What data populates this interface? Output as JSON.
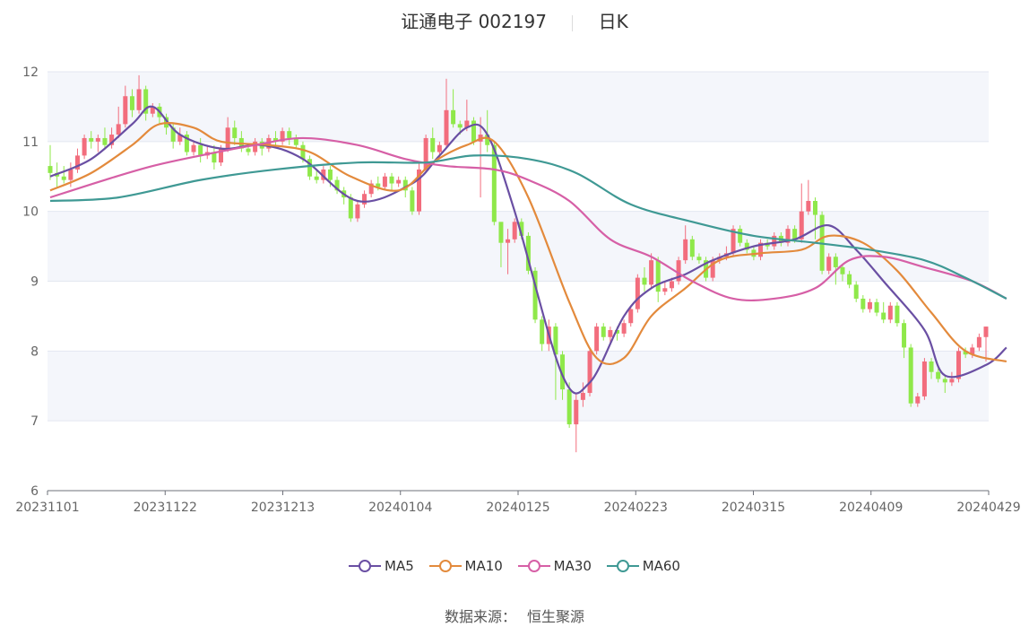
{
  "header": {
    "stock_name": "证通电子 002197",
    "period": "日K"
  },
  "source": {
    "label": "数据来源：",
    "provider": "恒生聚源"
  },
  "legend": [
    {
      "name": "MA5",
      "color": "#6a4fa3"
    },
    {
      "name": "MA10",
      "color": "#e38a3c"
    },
    {
      "name": "MA30",
      "color": "#d65fa6"
    },
    {
      "name": "MA60",
      "color": "#3f9994"
    }
  ],
  "colors": {
    "up": "#f26d7d",
    "down": "#8fe84a",
    "band": "#f4f6fb",
    "grid": "#e3e7f0"
  },
  "chart_data": {
    "type": "candlestick",
    "title": "证通电子 002197",
    "ylim": [
      6,
      12
    ],
    "y_ticks": [
      6,
      7,
      8,
      9,
      10,
      11,
      12
    ],
    "x_ticks": [
      "20231101",
      "20231122",
      "20231213",
      "20240104",
      "20240125",
      "20240223",
      "20240315",
      "20240409",
      "20240429"
    ],
    "candles": [
      [
        10.65,
        10.55,
        10.95,
        10.45
      ],
      [
        10.55,
        10.5,
        10.7,
        10.35
      ],
      [
        10.5,
        10.45,
        10.65,
        10.4
      ],
      [
        10.45,
        10.6,
        10.7,
        10.35
      ],
      [
        10.6,
        10.8,
        10.9,
        10.55
      ],
      [
        10.8,
        11.05,
        11.1,
        10.75
      ],
      [
        11.05,
        11.0,
        11.15,
        10.9
      ],
      [
        11.0,
        11.05,
        11.1,
        10.85
      ],
      [
        11.05,
        10.95,
        11.2,
        10.9
      ],
      [
        10.95,
        11.1,
        11.2,
        10.9
      ],
      [
        11.1,
        11.25,
        11.5,
        11.05
      ],
      [
        11.25,
        11.65,
        11.8,
        11.2
      ],
      [
        11.65,
        11.45,
        11.75,
        11.35
      ],
      [
        11.45,
        11.75,
        11.95,
        11.4
      ],
      [
        11.75,
        11.4,
        11.8,
        11.3
      ],
      [
        11.4,
        11.5,
        11.55,
        11.35
      ],
      [
        11.5,
        11.35,
        11.55,
        11.25
      ],
      [
        11.35,
        11.2,
        11.4,
        11.1
      ],
      [
        11.2,
        11.0,
        11.25,
        10.9
      ],
      [
        11.0,
        11.1,
        11.2,
        10.95
      ],
      [
        11.1,
        10.85,
        11.15,
        10.8
      ],
      [
        10.85,
        10.95,
        11.0,
        10.8
      ],
      [
        10.95,
        10.8,
        11.05,
        10.7
      ],
      [
        10.8,
        10.85,
        10.95,
        10.75
      ],
      [
        10.85,
        10.7,
        10.95,
        10.6
      ],
      [
        10.7,
        10.9,
        10.95,
        10.65
      ],
      [
        10.9,
        11.2,
        11.35,
        10.85
      ],
      [
        11.2,
        11.05,
        11.3,
        10.95
      ],
      [
        11.05,
        10.9,
        11.15,
        10.85
      ],
      [
        10.9,
        10.85,
        10.95,
        10.8
      ],
      [
        10.85,
        11.0,
        11.05,
        10.8
      ],
      [
        11.0,
        10.9,
        11.05,
        10.8
      ],
      [
        10.9,
        11.05,
        11.1,
        10.85
      ],
      [
        11.05,
        11.0,
        11.15,
        10.95
      ],
      [
        11.0,
        11.15,
        11.2,
        10.95
      ],
      [
        11.15,
        11.05,
        11.2,
        10.95
      ],
      [
        11.05,
        10.95,
        11.1,
        10.9
      ],
      [
        10.95,
        10.75,
        11.0,
        10.7
      ],
      [
        10.75,
        10.5,
        10.8,
        10.45
      ],
      [
        10.5,
        10.45,
        10.6,
        10.4
      ],
      [
        10.45,
        10.6,
        10.65,
        10.4
      ],
      [
        10.6,
        10.45,
        10.65,
        10.35
      ],
      [
        10.45,
        10.3,
        10.5,
        10.25
      ],
      [
        10.3,
        10.2,
        10.35,
        10.1
      ],
      [
        10.2,
        9.9,
        10.25,
        9.85
      ],
      [
        9.9,
        10.1,
        10.15,
        9.85
      ],
      [
        10.1,
        10.25,
        10.3,
        10.05
      ],
      [
        10.25,
        10.4,
        10.45,
        10.2
      ],
      [
        10.4,
        10.35,
        10.5,
        10.3
      ],
      [
        10.35,
        10.5,
        10.55,
        10.3
      ],
      [
        10.5,
        10.4,
        10.55,
        10.3
      ],
      [
        10.4,
        10.45,
        10.5,
        10.35
      ],
      [
        10.45,
        10.3,
        10.5,
        10.2
      ],
      [
        10.3,
        10.0,
        10.35,
        9.95
      ],
      [
        10.0,
        10.6,
        10.7,
        9.95
      ],
      [
        10.6,
        11.05,
        11.1,
        10.55
      ],
      [
        11.05,
        10.85,
        11.2,
        10.75
      ],
      [
        10.85,
        10.95,
        11.0,
        10.75
      ],
      [
        10.95,
        11.45,
        11.9,
        10.9
      ],
      [
        11.45,
        11.25,
        11.75,
        11.2
      ],
      [
        11.25,
        11.2,
        11.3,
        11.1
      ],
      [
        11.2,
        11.3,
        11.6,
        11.15
      ],
      [
        11.3,
        11.0,
        11.35,
        10.95
      ],
      [
        11.0,
        11.1,
        11.35,
        10.2
      ],
      [
        11.1,
        10.95,
        11.45,
        10.85
      ],
      [
        10.95,
        9.85,
        11.0,
        9.8
      ],
      [
        9.85,
        9.55,
        9.75,
        9.2
      ],
      [
        9.55,
        9.6,
        9.75,
        9.1
      ],
      [
        9.6,
        9.85,
        9.9,
        9.55
      ],
      [
        9.85,
        9.65,
        9.9,
        9.6
      ],
      [
        9.65,
        9.15,
        9.7,
        9.1
      ],
      [
        9.15,
        8.45,
        9.2,
        8.4
      ],
      [
        8.45,
        8.1,
        8.5,
        8.0
      ],
      [
        8.1,
        8.35,
        8.45,
        8.0
      ],
      [
        8.35,
        7.95,
        8.4,
        7.3
      ],
      [
        7.95,
        7.45,
        8.0,
        7.3
      ],
      [
        7.45,
        6.95,
        7.55,
        6.9
      ],
      [
        6.95,
        7.3,
        7.4,
        6.55
      ],
      [
        7.3,
        7.4,
        7.55,
        7.2
      ],
      [
        7.4,
        8.0,
        8.05,
        7.35
      ],
      [
        8.0,
        8.35,
        8.4,
        7.95
      ],
      [
        8.35,
        8.2,
        8.4,
        8.15
      ],
      [
        8.2,
        8.3,
        8.35,
        8.1
      ],
      [
        8.3,
        8.25,
        8.35,
        8.15
      ],
      [
        8.25,
        8.4,
        8.45,
        8.2
      ],
      [
        8.4,
        8.6,
        8.65,
        8.35
      ],
      [
        8.6,
        9.05,
        9.1,
        8.55
      ],
      [
        9.05,
        8.95,
        9.2,
        8.85
      ],
      [
        8.95,
        9.3,
        9.4,
        8.9
      ],
      [
        9.3,
        8.85,
        9.35,
        8.7
      ],
      [
        8.85,
        8.9,
        9.0,
        8.8
      ],
      [
        8.9,
        9.0,
        9.05,
        8.85
      ],
      [
        9.0,
        9.3,
        9.35,
        8.95
      ],
      [
        9.3,
        9.6,
        9.8,
        9.25
      ],
      [
        9.6,
        9.35,
        9.65,
        9.3
      ],
      [
        9.35,
        9.3,
        9.4,
        9.25
      ],
      [
        9.3,
        9.05,
        9.35,
        9.0
      ],
      [
        9.05,
        9.3,
        9.35,
        9.0
      ],
      [
        9.3,
        9.35,
        9.4,
        9.25
      ],
      [
        9.35,
        9.4,
        9.5,
        9.3
      ],
      [
        9.4,
        9.75,
        9.8,
        9.35
      ],
      [
        9.75,
        9.55,
        9.8,
        9.5
      ],
      [
        9.55,
        9.45,
        9.6,
        9.4
      ],
      [
        9.45,
        9.35,
        9.5,
        9.3
      ],
      [
        9.35,
        9.55,
        9.6,
        9.3
      ],
      [
        9.55,
        9.5,
        9.6,
        9.45
      ],
      [
        9.5,
        9.65,
        9.7,
        9.45
      ],
      [
        9.65,
        9.55,
        9.7,
        9.5
      ],
      [
        9.55,
        9.75,
        9.8,
        9.5
      ],
      [
        9.75,
        9.6,
        9.8,
        9.55
      ],
      [
        9.6,
        10.0,
        10.4,
        9.55
      ],
      [
        10.0,
        10.15,
        10.45,
        9.95
      ],
      [
        10.15,
        9.95,
        10.2,
        9.6
      ],
      [
        9.95,
        9.15,
        10.0,
        9.1
      ],
      [
        9.15,
        9.35,
        9.4,
        9.1
      ],
      [
        9.35,
        9.2,
        9.4,
        8.95
      ],
      [
        9.2,
        9.1,
        9.25,
        9.0
      ],
      [
        9.1,
        8.95,
        9.15,
        8.9
      ],
      [
        8.95,
        8.75,
        9.0,
        8.7
      ],
      [
        8.75,
        8.6,
        8.8,
        8.55
      ],
      [
        8.6,
        8.7,
        8.75,
        8.55
      ],
      [
        8.7,
        8.55,
        8.75,
        8.5
      ],
      [
        8.55,
        8.45,
        8.7,
        8.4
      ],
      [
        8.45,
        8.65,
        8.7,
        8.4
      ],
      [
        8.65,
        8.4,
        8.7,
        8.35
      ],
      [
        8.4,
        8.05,
        8.45,
        7.9
      ],
      [
        8.05,
        7.25,
        8.1,
        7.2
      ],
      [
        7.25,
        7.35,
        7.4,
        7.2
      ],
      [
        7.35,
        7.85,
        7.9,
        7.3
      ],
      [
        7.85,
        7.7,
        7.9,
        7.6
      ],
      [
        7.7,
        7.6,
        7.75,
        7.55
      ],
      [
        7.6,
        7.55,
        7.65,
        7.4
      ],
      [
        7.55,
        7.6,
        7.7,
        7.5
      ],
      [
        7.6,
        8.0,
        8.05,
        7.55
      ],
      [
        8.0,
        7.95,
        8.05,
        7.9
      ],
      [
        7.95,
        8.05,
        8.1,
        7.9
      ],
      [
        8.05,
        8.2,
        8.25,
        8.0
      ],
      [
        8.2,
        8.35,
        8.35,
        7.85
      ]
    ],
    "series": [
      {
        "name": "MA5",
        "points": [
          [
            0,
            10.5
          ],
          [
            6,
            10.75
          ],
          [
            12,
            11.25
          ],
          [
            15,
            11.5
          ],
          [
            19,
            11.1
          ],
          [
            25,
            10.9
          ],
          [
            31,
            10.95
          ],
          [
            37,
            10.75
          ],
          [
            45,
            10.15
          ],
          [
            53,
            10.4
          ],
          [
            57,
            10.8
          ],
          [
            61,
            11.2
          ],
          [
            64,
            11.1
          ],
          [
            68,
            10.0
          ],
          [
            75,
            7.65
          ],
          [
            79,
            7.55
          ],
          [
            84,
            8.5
          ],
          [
            88,
            8.9
          ],
          [
            93,
            9.1
          ],
          [
            97,
            9.3
          ],
          [
            103,
            9.5
          ],
          [
            109,
            9.6
          ],
          [
            114,
            9.8
          ],
          [
            118,
            9.45
          ],
          [
            122,
            9.0
          ],
          [
            128,
            8.3
          ],
          [
            131,
            7.65
          ],
          [
            137,
            7.8
          ],
          [
            140,
            8.05
          ]
        ]
      },
      {
        "name": "MA10",
        "points": [
          [
            0,
            10.3
          ],
          [
            6,
            10.55
          ],
          [
            12,
            10.95
          ],
          [
            16,
            11.25
          ],
          [
            21,
            11.2
          ],
          [
            25,
            11.0
          ],
          [
            32,
            10.95
          ],
          [
            38,
            10.85
          ],
          [
            44,
            10.5
          ],
          [
            51,
            10.3
          ],
          [
            56,
            10.7
          ],
          [
            61,
            10.95
          ],
          [
            65,
            11.0
          ],
          [
            70,
            10.2
          ],
          [
            76,
            8.7
          ],
          [
            80,
            7.9
          ],
          [
            84,
            7.9
          ],
          [
            88,
            8.5
          ],
          [
            93,
            8.9
          ],
          [
            98,
            9.3
          ],
          [
            104,
            9.4
          ],
          [
            110,
            9.45
          ],
          [
            114,
            9.65
          ],
          [
            119,
            9.55
          ],
          [
            124,
            9.15
          ],
          [
            129,
            8.55
          ],
          [
            134,
            8.0
          ],
          [
            140,
            7.85
          ]
        ]
      },
      {
        "name": "MA30",
        "points": [
          [
            0,
            10.2
          ],
          [
            8,
            10.45
          ],
          [
            15,
            10.65
          ],
          [
            22,
            10.8
          ],
          [
            30,
            10.95
          ],
          [
            37,
            11.05
          ],
          [
            45,
            10.95
          ],
          [
            52,
            10.75
          ],
          [
            58,
            10.65
          ],
          [
            65,
            10.6
          ],
          [
            70,
            10.45
          ],
          [
            76,
            10.15
          ],
          [
            82,
            9.6
          ],
          [
            88,
            9.35
          ],
          [
            94,
            9.0
          ],
          [
            100,
            8.75
          ],
          [
            106,
            8.75
          ],
          [
            112,
            8.9
          ],
          [
            117,
            9.3
          ],
          [
            122,
            9.35
          ],
          [
            128,
            9.2
          ],
          [
            135,
            9.0
          ],
          [
            140,
            8.75
          ]
        ]
      },
      {
        "name": "MA60",
        "points": [
          [
            0,
            10.15
          ],
          [
            10,
            10.2
          ],
          [
            22,
            10.45
          ],
          [
            33,
            10.6
          ],
          [
            45,
            10.7
          ],
          [
            55,
            10.7
          ],
          [
            62,
            10.8
          ],
          [
            70,
            10.75
          ],
          [
            77,
            10.55
          ],
          [
            85,
            10.1
          ],
          [
            94,
            9.85
          ],
          [
            103,
            9.65
          ],
          [
            112,
            9.55
          ],
          [
            120,
            9.45
          ],
          [
            128,
            9.3
          ],
          [
            134,
            9.05
          ],
          [
            140,
            8.75
          ]
        ]
      }
    ]
  }
}
